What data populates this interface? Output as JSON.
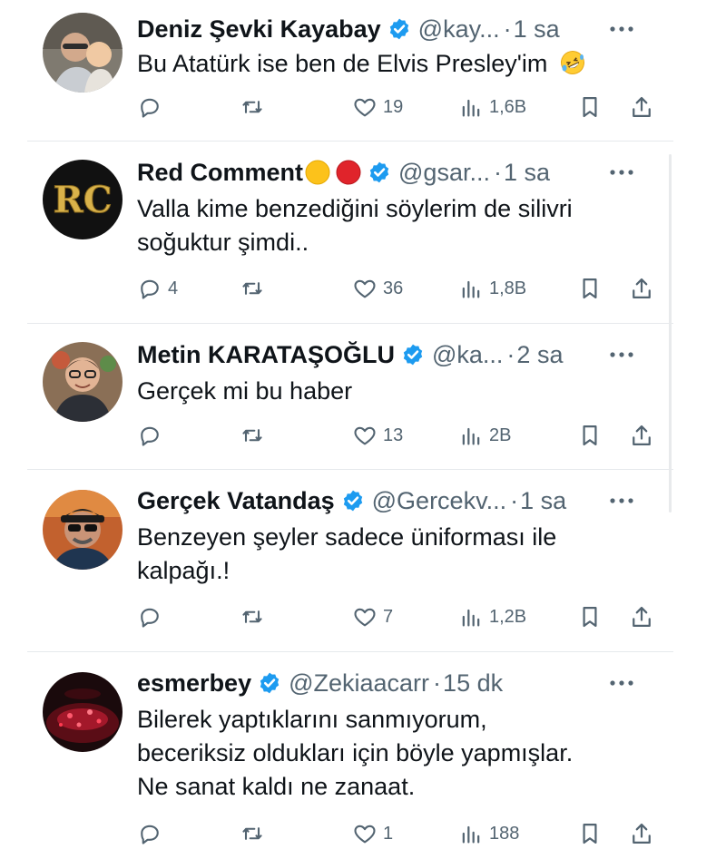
{
  "tweets": [
    {
      "name": "Deniz Şevki Kayabay",
      "name_emojis": [],
      "handle": "@kay...",
      "time": "1 sa",
      "lines": [
        "Bu Atatürk ise ben de Elvis Presley'im"
      ],
      "trailing_emoji": "rofl-emoji",
      "replies": "",
      "retweets": "",
      "likes": "19",
      "views": "1,6B",
      "avatar": "photo-man-with-child"
    },
    {
      "name": "Red Comment",
      "name_emojis": [
        "yellow-circle-emoji",
        "red-circle-emoji"
      ],
      "handle": "@gsar...",
      "time": "1 sa",
      "lines": [
        "Valla kime benzediğini söylerim de silivri",
        "soğuktur şimdi.."
      ],
      "trailing_emoji": "",
      "replies": "4",
      "retweets": "",
      "likes": "36",
      "views": "1,8B",
      "avatar": "rc-logo"
    },
    {
      "name": "Metin KARATAŞOĞLU",
      "name_emojis": [],
      "handle": "@ka...",
      "time": "2 sa",
      "lines": [
        "Gerçek mi bu haber"
      ],
      "trailing_emoji": "",
      "replies": "",
      "retweets": "",
      "likes": "13",
      "views": "2B",
      "avatar": "photo-man-glasses"
    },
    {
      "name": "Gerçek Vatandaş",
      "name_emojis": [],
      "handle": "@Gercekv...",
      "time": "1 sa",
      "lines": [
        "Benzeyen şeyler sadece üniforması ile",
        "kalpağı.!"
      ],
      "trailing_emoji": "",
      "replies": "",
      "retweets": "",
      "likes": "7",
      "views": "1,2B",
      "avatar": "photo-man-sunglasses"
    },
    {
      "name": "esmerbey",
      "name_emojis": [],
      "handle": "@Zekiaacarr",
      "time": "15 dk",
      "lines": [
        "Bilerek yaptıklarını sanmıyorum,",
        "beceriksiz oldukları için böyle yapmışlar.",
        "Ne sanat kaldı ne zanaat."
      ],
      "trailing_emoji": "",
      "replies": "",
      "retweets": "",
      "likes": "1",
      "views": "188",
      "avatar": "photo-stadium-red"
    }
  ],
  "separator_dot": "·",
  "colors": {
    "verified": "#1d9bf0",
    "text": "#0f1419",
    "muted": "#536471",
    "divider": "#e6e9ec"
  }
}
